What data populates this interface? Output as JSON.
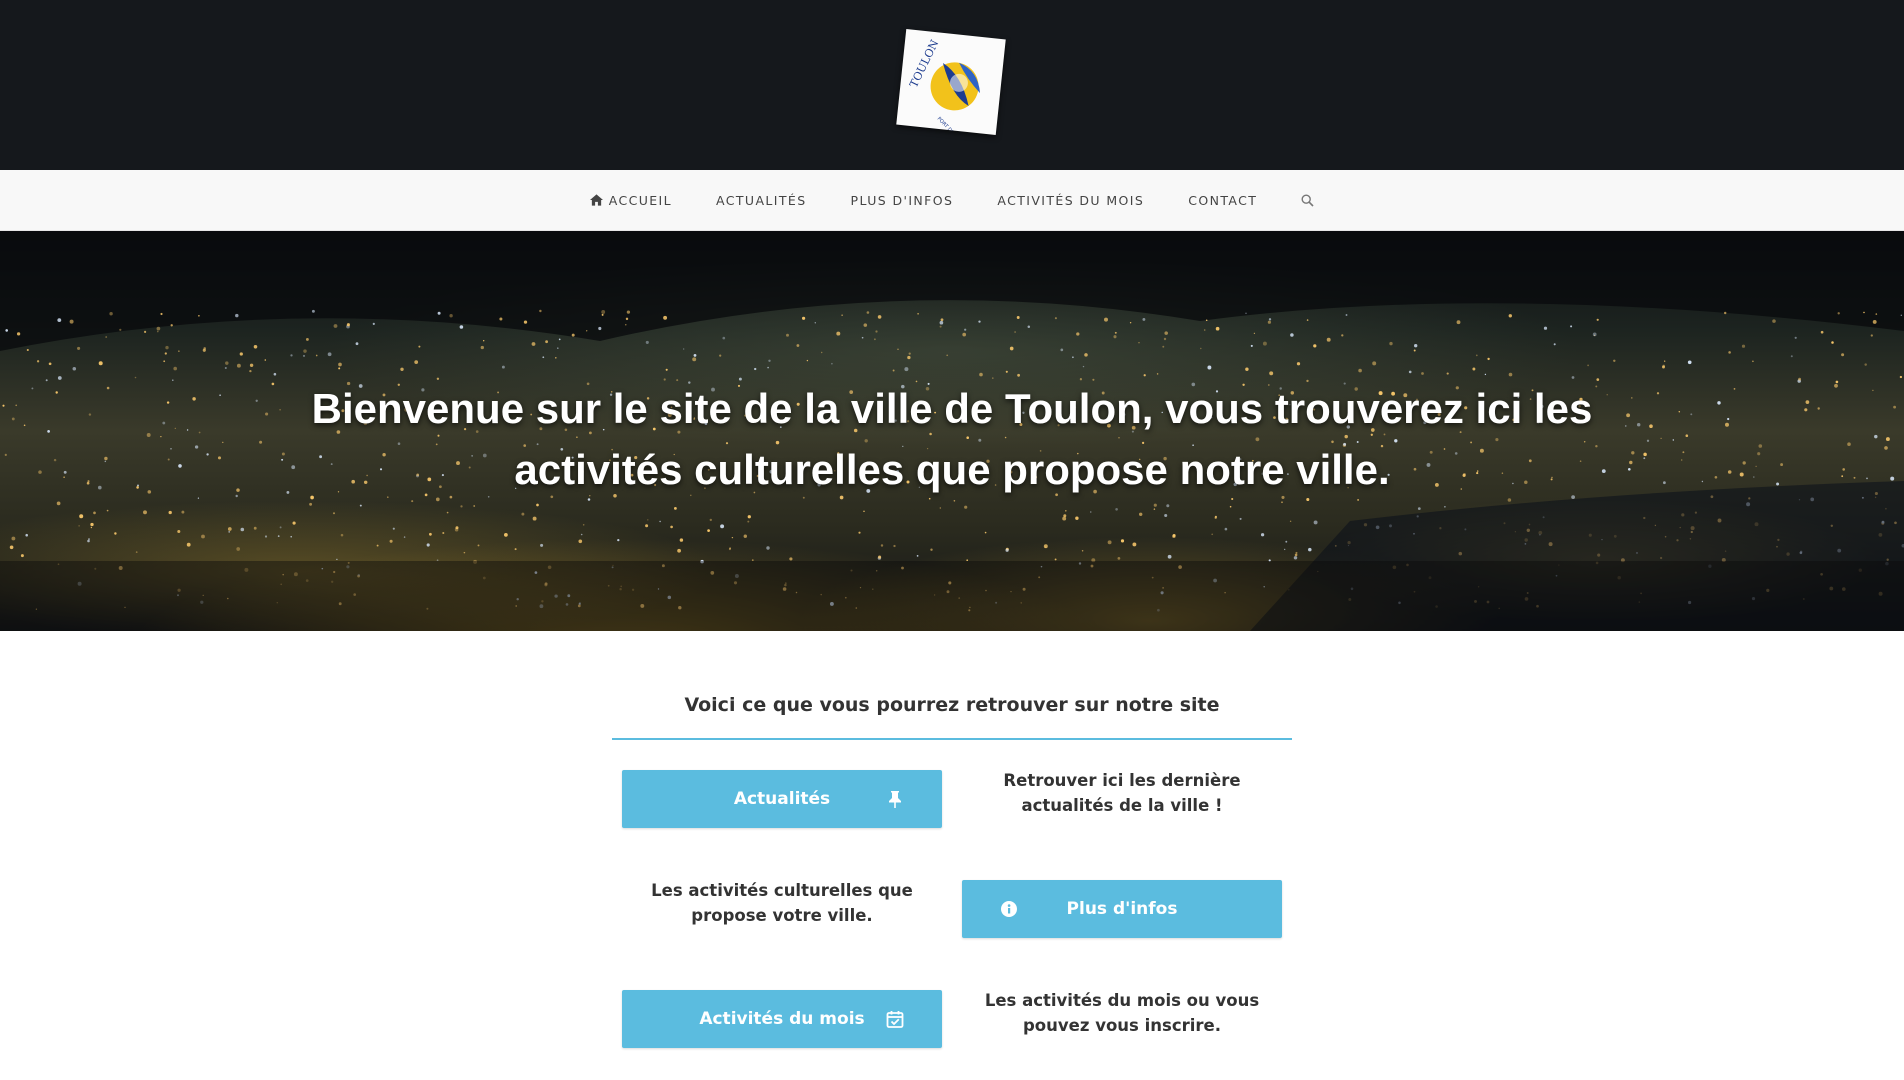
{
  "logo": {
    "top_text": "TOULON",
    "bottom_text": "PORT DU LEVANT"
  },
  "nav": {
    "items": [
      {
        "label": "ACCUEIL",
        "icon": "home-icon"
      },
      {
        "label": "ACTUALITÉS"
      },
      {
        "label": "PLUS D'INFOS"
      },
      {
        "label": "ACTIVITÉS DU MOIS"
      },
      {
        "label": "CONTACT"
      }
    ],
    "search_icon": "search-icon"
  },
  "hero": {
    "text": "Bienvenue sur le site de la ville de Toulon, vous trouverez ici les activités culturelles que propose notre ville."
  },
  "main": {
    "title": "Voici ce que vous pourrez retrouver sur notre site",
    "accent_color": "#5bbcdf",
    "rows": [
      {
        "button_label": "Actualités",
        "button_icon": "pin-icon",
        "description": "Retrouver ici les dernière actualités de la ville !"
      },
      {
        "button_label": "Plus d'infos",
        "button_icon": "info-icon",
        "description": "Les activités culturelles que propose votre ville."
      },
      {
        "button_label": "Activités du mois",
        "button_icon": "calendar-check-icon",
        "description": "Les activités du mois ou vous pouvez vous inscrire."
      }
    ]
  }
}
